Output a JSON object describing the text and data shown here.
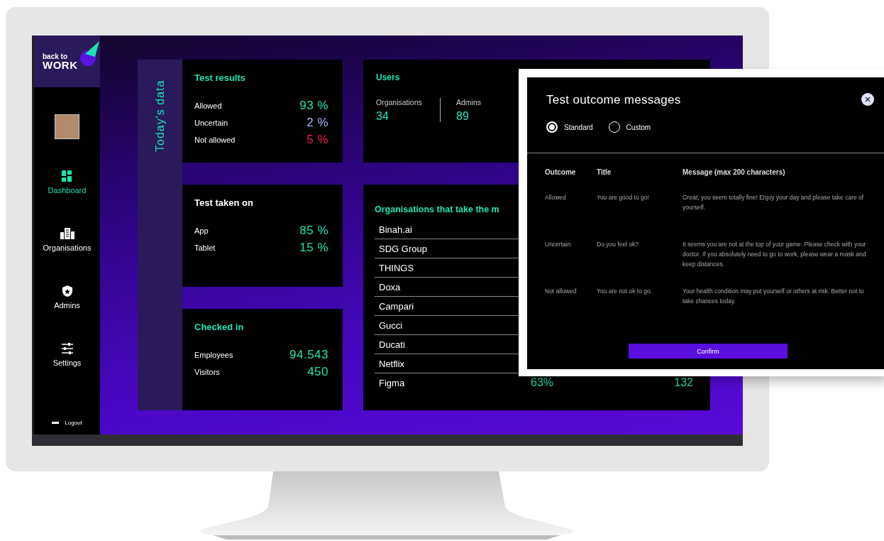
{
  "sidebar": {
    "logo": {
      "line_1": "back to",
      "line_2": "WORK"
    },
    "items": [
      {
        "label": "Dashboard",
        "kind": "dashboard",
        "selected": true
      },
      {
        "label": "Organisations",
        "kind": "buildings",
        "selected": false
      },
      {
        "label": "Admins",
        "kind": "shield",
        "selected": false
      },
      {
        "label": "Settings",
        "kind": "sliders",
        "selected": false
      }
    ],
    "logout": "Logout"
  },
  "section_label": "Today's data",
  "cards": [
    {
      "title": "Test results",
      "color": "#19e3b1",
      "rows": [
        {
          "label": "Allowed",
          "value": "93 %",
          "color": "#19e3b1"
        },
        {
          "label": "Uncertain",
          "value": "2 %",
          "color": "#aab8ff"
        },
        {
          "label": "Not allowed",
          "value": "5 %",
          "color": "#e8204c"
        }
      ]
    },
    {
      "title": "Test taken on",
      "color": "#ffffff",
      "rows": [
        {
          "label": "App",
          "value": "85 %",
          "color": "#19e3b1"
        },
        {
          "label": "Tablet",
          "value": "15 %",
          "color": "#19e3b1"
        }
      ]
    },
    {
      "title": "Checked in",
      "color": "#19e3b1",
      "rows": [
        {
          "label": "Employees",
          "value": "94.543",
          "color": "#19e3b1"
        },
        {
          "label": "Visitors",
          "value": "450",
          "color": "#19e3b1"
        }
      ]
    }
  ],
  "users": {
    "title": "Users",
    "stats": [
      {
        "label": "Organisations",
        "value": "34"
      },
      {
        "label": "Admins",
        "value": "89"
      }
    ]
  },
  "organisations": {
    "title": "Organisations that take the m",
    "rows": [
      {
        "name": "Binah.ai"
      },
      {
        "name": "SDG Group"
      },
      {
        "name": "THINGS"
      },
      {
        "name": "Doxa"
      },
      {
        "name": "Campari"
      },
      {
        "name": "Gucci"
      },
      {
        "name": "Ducati"
      },
      {
        "name": "Netflix"
      },
      {
        "name": "Figma",
        "column_2": "63%",
        "column_3": "132"
      }
    ]
  },
  "modal": {
    "title": "Test outcome messages",
    "options": [
      {
        "label": "Standard",
        "selected": true
      },
      {
        "label": "Custom",
        "selected": false
      }
    ],
    "columns": [
      "Outcome",
      "Title",
      "Message (max 200 characters)"
    ],
    "rows": [
      {
        "outcome": "Allowed",
        "title": "You are good to go!",
        "message": "Great, you seem totally fine! Enjoy your day and please take care of yourself."
      },
      {
        "outcome": "Uncertain",
        "title": "Do you feel ok?",
        "message": "It seems you are not at the top of your game. Please check with your doctor. If you absolutely need to go to work, please wear a mask and keep distances."
      },
      {
        "outcome": "Not allowed",
        "title": "You are not ok to go.",
        "message": "Your health condition may put yourself or others at risk. Better not to take chances today."
      }
    ],
    "confirm": "Confirm"
  }
}
